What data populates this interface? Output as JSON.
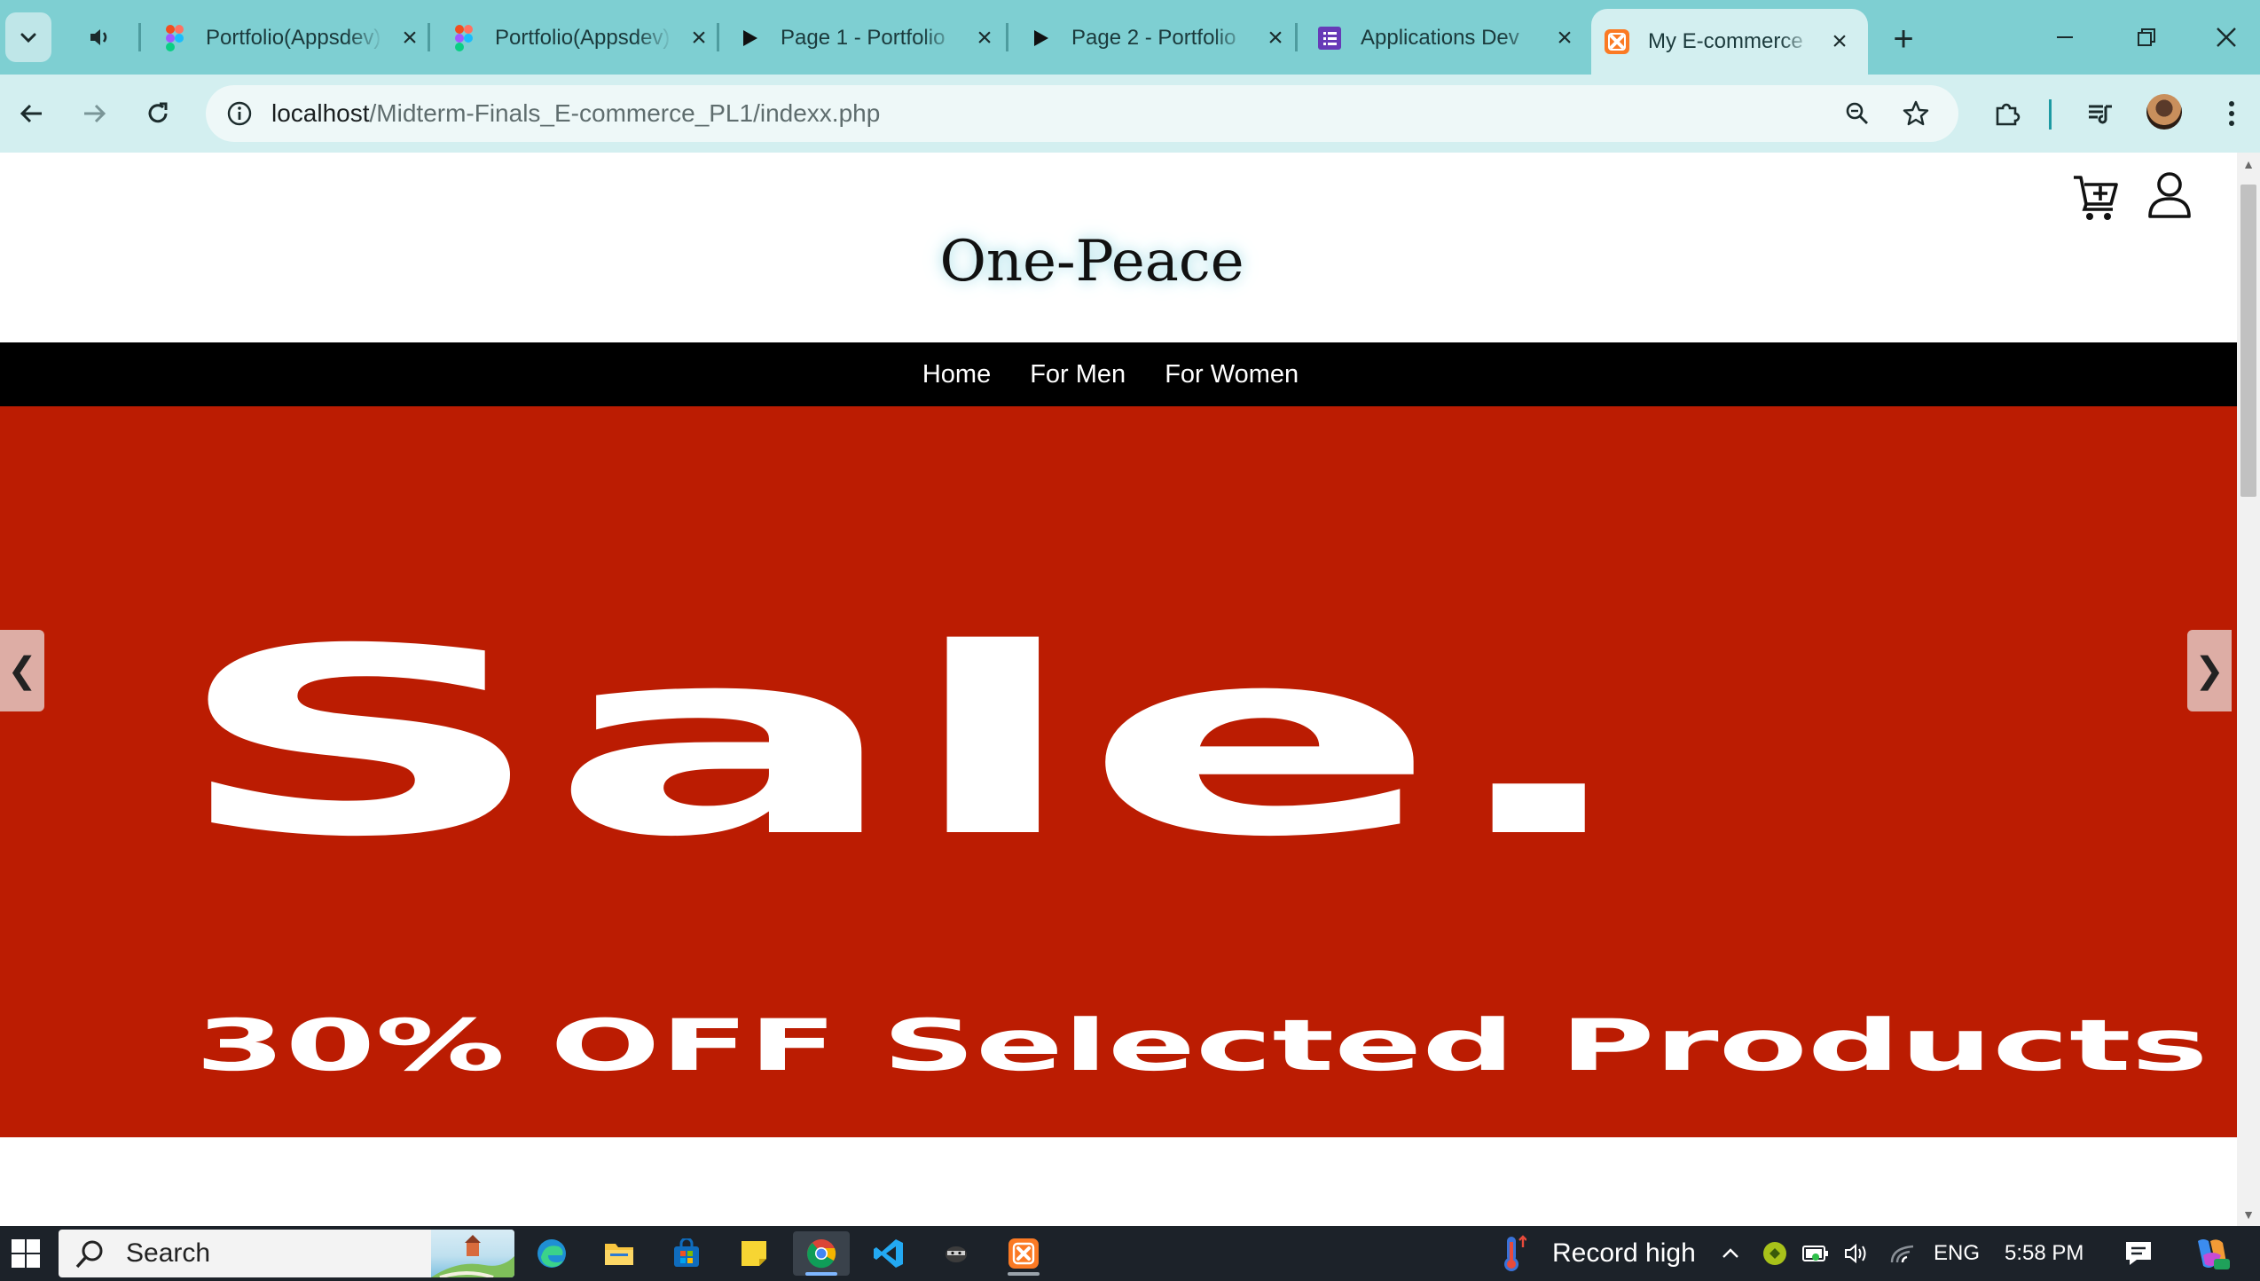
{
  "browser": {
    "tabs": [
      {
        "title": "Portfolio(Appsdev)",
        "icon": "figma-icon"
      },
      {
        "title": "Portfolio(Appsdev)",
        "icon": "figma-icon"
      },
      {
        "title": "Page 1 - Portfolio",
        "icon": "play-icon"
      },
      {
        "title": "Page 2 - Portfolio",
        "icon": "play-icon"
      },
      {
        "title": "Applications Dev",
        "icon": "forms-icon"
      },
      {
        "title": "My E-commerce",
        "icon": "xampp-icon",
        "active": true
      }
    ],
    "url_host": "localhost",
    "url_path": "/Midterm-Finals_E-commerce_PL1/indexx.php"
  },
  "site": {
    "brand": "One-Peace",
    "nav": [
      "Home",
      "For Men",
      "For Women"
    ],
    "hero": {
      "headline": "Sale.",
      "subline": "30% OFF Selected Products",
      "prev": "❮",
      "next": "❯"
    }
  },
  "taskbar": {
    "search_label": "Search",
    "weather": "Record high",
    "language": "ENG",
    "time": "5:58 PM"
  },
  "colors": {
    "tabbar": "#7ecfd2",
    "toolbar": "#d3eff0",
    "nav_bg": "#000000",
    "hero_bg": "#bb1c02",
    "taskbar": "#1c2229"
  }
}
